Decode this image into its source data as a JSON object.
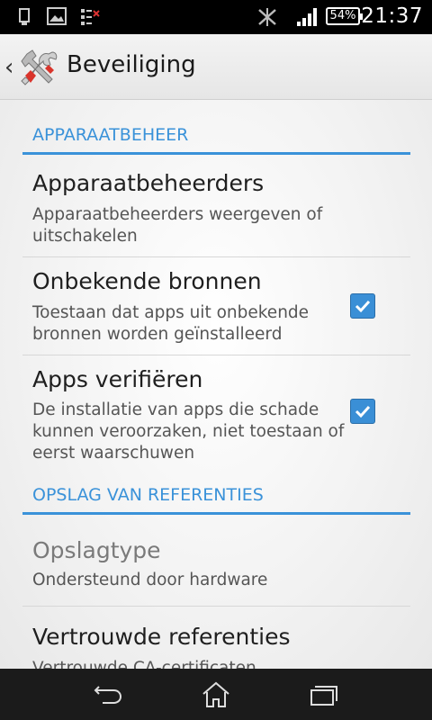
{
  "status_bar": {
    "time": "21:37",
    "battery": "54%",
    "icons": [
      "usb-icon",
      "image-icon",
      "storage-icon",
      "bluetooth-off-icon",
      "signal-icon",
      "battery-icon"
    ]
  },
  "action_bar": {
    "title": "Beveiliging",
    "icon": "settings-tools-icon"
  },
  "sections": [
    {
      "header": "APPARAATBEHEER",
      "items": [
        {
          "title": "Apparaatbeheerders",
          "subtitle": "Apparaatbeheerders weergeven of uitschakelen"
        },
        {
          "title": "Onbekende bronnen",
          "subtitle": "Toestaan dat apps uit onbekende bronnen worden geïnstalleerd",
          "checked": true
        },
        {
          "title": "Apps verifiëren",
          "subtitle": "De installatie van apps die schade kunnen veroorzaken, niet toestaan of eerst waarschuwen",
          "checked": true
        }
      ]
    },
    {
      "header": "OPSLAG VAN REFERENTIES",
      "items": [
        {
          "title": "Opslagtype",
          "subtitle": "Ondersteund door hardware"
        },
        {
          "title": "Vertrouwde referenties",
          "subtitle": "Vertrouwde CA-certificaten weergeven"
        }
      ]
    }
  ],
  "nav_bar": [
    "back-icon",
    "home-icon",
    "recent-apps-icon"
  ],
  "colors": {
    "accent": "#3a92d9",
    "status_bar": "#000000",
    "nav_bar": "#1b1b1b"
  }
}
